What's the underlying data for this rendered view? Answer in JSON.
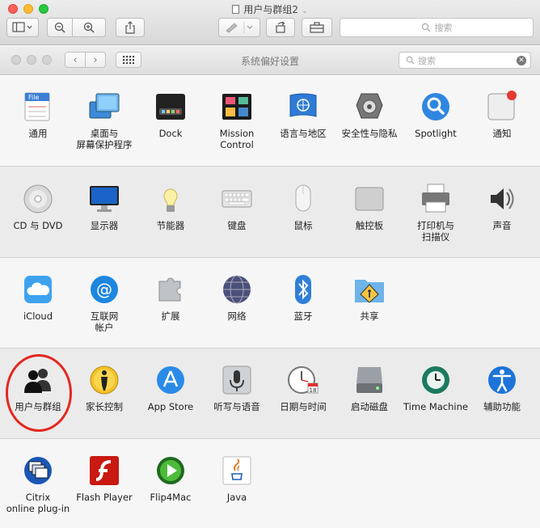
{
  "outer_window": {
    "title": "用户与群组2",
    "search_placeholder": "搜索"
  },
  "prefs_window": {
    "title": "系统偏好设置",
    "search_placeholder": "搜索"
  },
  "rows": [
    [
      {
        "icon": "general-icon",
        "label": [
          "通用"
        ]
      },
      {
        "icon": "desktop-screensaver-icon",
        "label": [
          "桌面与",
          "屏幕保护程序"
        ]
      },
      {
        "icon": "dock-icon",
        "label": [
          "Dock"
        ]
      },
      {
        "icon": "mission-control-icon",
        "label": [
          "Mission",
          "Control"
        ]
      },
      {
        "icon": "language-region-icon",
        "label": [
          "语言与地区"
        ]
      },
      {
        "icon": "security-privacy-icon",
        "label": [
          "安全性与隐私"
        ]
      },
      {
        "icon": "spotlight-icon",
        "label": [
          "Spotlight"
        ]
      },
      {
        "icon": "notifications-icon",
        "label": [
          "通知"
        ]
      }
    ],
    [
      {
        "icon": "cd-dvd-icon",
        "label": [
          "CD 与 DVD"
        ]
      },
      {
        "icon": "displays-icon",
        "label": [
          "显示器"
        ]
      },
      {
        "icon": "energy-saver-icon",
        "label": [
          "节能器"
        ]
      },
      {
        "icon": "keyboard-icon",
        "label": [
          "键盘"
        ]
      },
      {
        "icon": "mouse-icon",
        "label": [
          "鼠标"
        ]
      },
      {
        "icon": "trackpad-icon",
        "label": [
          "触控板"
        ]
      },
      {
        "icon": "printer-scanner-icon",
        "label": [
          "打印机与",
          "扫描仪"
        ]
      },
      {
        "icon": "sound-icon",
        "label": [
          "声音"
        ]
      }
    ],
    [
      {
        "icon": "icloud-icon",
        "label": [
          "iCloud"
        ]
      },
      {
        "icon": "internet-accounts-icon",
        "label": [
          "互联网",
          "帐户"
        ]
      },
      {
        "icon": "extensions-icon",
        "label": [
          "扩展"
        ]
      },
      {
        "icon": "network-icon",
        "label": [
          "网络"
        ]
      },
      {
        "icon": "bluetooth-icon",
        "label": [
          "蓝牙"
        ]
      },
      {
        "icon": "sharing-icon",
        "label": [
          "共享"
        ]
      }
    ],
    [
      {
        "icon": "users-groups-icon",
        "label": [
          "用户与群组"
        ]
      },
      {
        "icon": "parental-controls-icon",
        "label": [
          "家长控制"
        ]
      },
      {
        "icon": "app-store-icon",
        "label": [
          "App Store"
        ]
      },
      {
        "icon": "dictation-speech-icon",
        "label": [
          "听写与语音"
        ]
      },
      {
        "icon": "date-time-icon",
        "label": [
          "日期与时间"
        ]
      },
      {
        "icon": "startup-disk-icon",
        "label": [
          "启动磁盘"
        ]
      },
      {
        "icon": "time-machine-icon",
        "label": [
          "Time Machine"
        ]
      },
      {
        "icon": "accessibility-icon",
        "label": [
          "辅助功能"
        ]
      }
    ],
    [
      {
        "icon": "citrix-icon",
        "label": [
          "Citrix",
          "online plug-in"
        ]
      },
      {
        "icon": "flash-player-icon",
        "label": [
          "Flash Player"
        ]
      },
      {
        "icon": "flip4mac-icon",
        "label": [
          "Flip4Mac"
        ]
      },
      {
        "icon": "java-icon",
        "label": [
          "Java"
        ]
      }
    ]
  ],
  "colors": {
    "highlight_circle": "#e3271f"
  }
}
